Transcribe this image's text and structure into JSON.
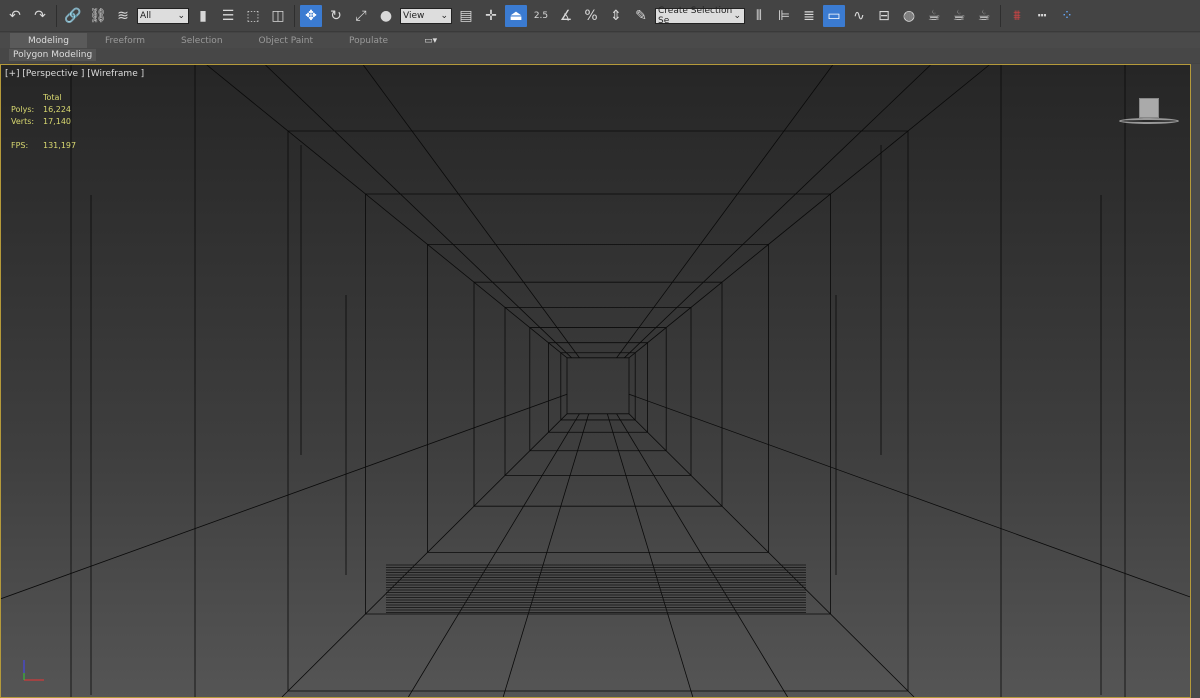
{
  "toolbar": {
    "selection_filter": "All",
    "reference_coord": "View",
    "snap_angle": "2.5",
    "named_selection_placeholder": "Create Selection Se",
    "icons": [
      "undo-icon",
      "redo-icon",
      "link-icon",
      "unlink-icon",
      "bind-space-warp-icon",
      "select-object-icon",
      "select-by-name-icon",
      "rect-selection-icon",
      "window-crossing-icon",
      "move-icon",
      "rotate-icon",
      "scale-icon",
      "place-icon",
      "use-pivot-icon",
      "select-manipulate-icon",
      "keyboard-shortcut-icon",
      "snap-toggle-icon",
      "angle-snap-icon",
      "percent-snap-icon",
      "spinner-snap-icon",
      "edit-named-sets-icon",
      "mirror-icon",
      "align-icon",
      "layer-explorer-icon",
      "scene-explorer-icon",
      "curve-editor-icon",
      "schematic-view-icon",
      "material-editor-icon",
      "render-setup-icon",
      "rendered-frame-icon",
      "render-icon",
      "civil-view-icon",
      "measure-icon",
      "particle-view-icon"
    ]
  },
  "ribbon": {
    "tabs": [
      "Modeling",
      "Freeform",
      "Selection",
      "Object Paint",
      "Populate"
    ],
    "active": "Modeling",
    "panel": "Polygon Modeling"
  },
  "viewport": {
    "label": "[+] [Perspective ] [Wireframe ]",
    "stats": {
      "header": "Total",
      "polys_label": "Polys:",
      "polys": "16,224",
      "verts_label": "Verts:",
      "verts": "17,140",
      "fps_label": "FPS:",
      "fps": "131,197"
    },
    "border_color": "#b59a3a"
  }
}
